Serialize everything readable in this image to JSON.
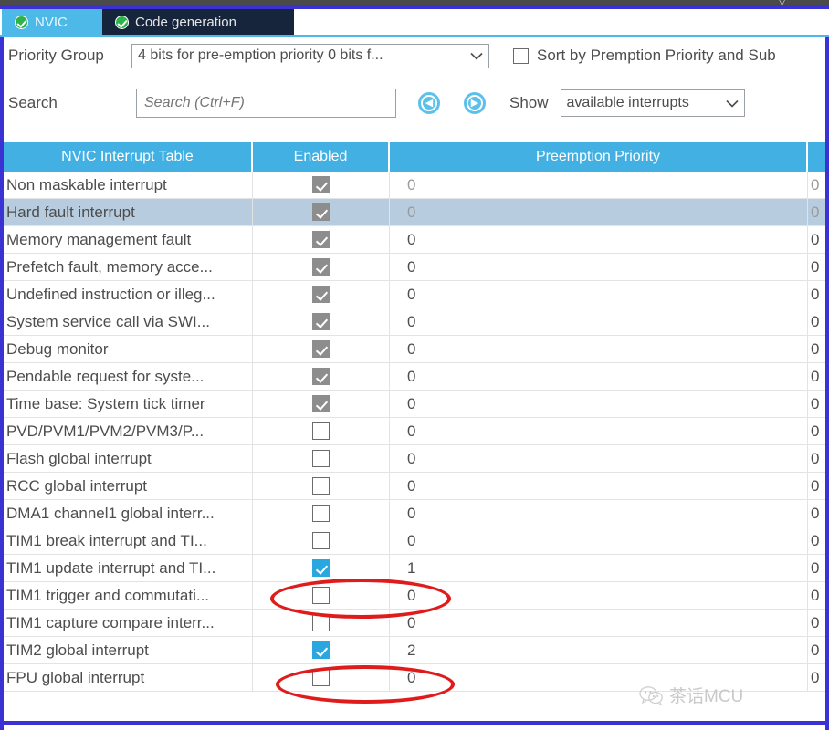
{
  "tabs": [
    {
      "label": "NVIC",
      "icon": "check-circle-icon",
      "active": true
    },
    {
      "label": "Code generation",
      "icon": "check-circle-icon",
      "active": false
    }
  ],
  "priority_group": {
    "label": "Priority Group",
    "value": "4 bits for pre-emption priority 0 bits f...",
    "caret_icon": "chevron-down-icon"
  },
  "sort_option": {
    "label": "Sort by Premption Priority and Sub",
    "checked": false,
    "checkbox_icon": "checkbox-unchecked-icon"
  },
  "search": {
    "label": "Search",
    "value": "",
    "placeholder": "Search (Ctrl+F)",
    "prev_icon": "circle-left-arrow-icon",
    "next_icon": "circle-right-arrow-icon"
  },
  "show": {
    "label": "Show",
    "value": "available interrupts",
    "caret_icon": "chevron-down-icon"
  },
  "table": {
    "columns": [
      "NVIC Interrupt Table",
      "Enabled",
      "Preemption Priority",
      ""
    ],
    "rows": [
      {
        "name": "Non maskable interrupt",
        "enabled": "locked",
        "preemption": "0",
        "sub": "0",
        "dim": true,
        "selected": false
      },
      {
        "name": "Hard fault interrupt",
        "enabled": "locked",
        "preemption": "0",
        "sub": "0",
        "dim": true,
        "selected": true
      },
      {
        "name": "Memory management fault",
        "enabled": "locked",
        "preemption": "0",
        "sub": "0",
        "dim": false,
        "selected": false
      },
      {
        "name": "Prefetch fault, memory acce...",
        "enabled": "locked",
        "preemption": "0",
        "sub": "0",
        "dim": false,
        "selected": false
      },
      {
        "name": "Undefined instruction or illeg...",
        "enabled": "locked",
        "preemption": "0",
        "sub": "0",
        "dim": false,
        "selected": false
      },
      {
        "name": "System service call via SWI...",
        "enabled": "locked",
        "preemption": "0",
        "sub": "0",
        "dim": false,
        "selected": false
      },
      {
        "name": "Debug monitor",
        "enabled": "locked",
        "preemption": "0",
        "sub": "0",
        "dim": false,
        "selected": false
      },
      {
        "name": "Pendable request for syste...",
        "enabled": "locked",
        "preemption": "0",
        "sub": "0",
        "dim": false,
        "selected": false
      },
      {
        "name": "Time base: System tick timer",
        "enabled": "locked",
        "preemption": "0",
        "sub": "0",
        "dim": false,
        "selected": false
      },
      {
        "name": "PVD/PVM1/PVM2/PVM3/P...",
        "enabled": "off",
        "preemption": "0",
        "sub": "0",
        "dim": false,
        "selected": false
      },
      {
        "name": "Flash global interrupt",
        "enabled": "off",
        "preemption": "0",
        "sub": "0",
        "dim": false,
        "selected": false
      },
      {
        "name": "RCC global interrupt",
        "enabled": "off",
        "preemption": "0",
        "sub": "0",
        "dim": false,
        "selected": false
      },
      {
        "name": "DMA1 channel1 global interr...",
        "enabled": "off",
        "preemption": "0",
        "sub": "0",
        "dim": false,
        "selected": false
      },
      {
        "name": "TIM1 break interrupt and TI...",
        "enabled": "off",
        "preemption": "0",
        "sub": "0",
        "dim": false,
        "selected": false
      },
      {
        "name": "TIM1 update interrupt and TI...",
        "enabled": "on",
        "preemption": "1",
        "sub": "0",
        "dim": false,
        "selected": false
      },
      {
        "name": "TIM1 trigger and commutati...",
        "enabled": "off",
        "preemption": "0",
        "sub": "0",
        "dim": false,
        "selected": false
      },
      {
        "name": "TIM1 capture compare interr...",
        "enabled": "off",
        "preemption": "0",
        "sub": "0",
        "dim": false,
        "selected": false
      },
      {
        "name": "TIM2 global interrupt",
        "enabled": "on",
        "preemption": "2",
        "sub": "0",
        "dim": false,
        "selected": false
      },
      {
        "name": "FPU global interrupt",
        "enabled": "off",
        "preemption": "0",
        "sub": "0",
        "dim": false,
        "selected": false
      }
    ]
  },
  "annotations": [
    {
      "shape": "ellipse",
      "color": "#e01b1b",
      "target_row": 14
    },
    {
      "shape": "ellipse",
      "color": "#e01b1b",
      "target_row": 17
    }
  ],
  "watermark": {
    "text": "茶话MCU",
    "icon": "wechat-icon"
  },
  "colors": {
    "header_blue": "#42b0e3",
    "tab_active": "#4cb9e8",
    "tab_inactive": "#16243c",
    "accent_border": "#3b32d4",
    "checkbox_on": "#2ba7e0",
    "checkbox_locked": "#8d8d8d",
    "row_selected": "#b7ccdf",
    "annotation_red": "#e01b1b"
  }
}
